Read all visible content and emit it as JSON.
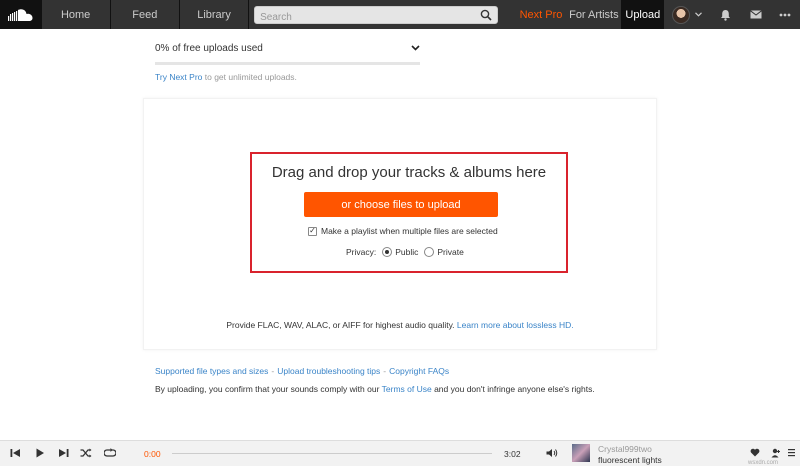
{
  "nav": {
    "home": "Home",
    "feed": "Feed",
    "library": "Library",
    "search_placeholder": "Search",
    "next_pro": "Next Pro",
    "for_artists": "For Artists",
    "upload": "Upload"
  },
  "quota": {
    "text": "0% of free uploads used",
    "percent": 0,
    "link_text": "Try Next Pro",
    "link_suffix": " to get unlimited uploads."
  },
  "dropzone": {
    "title": "Drag and drop your tracks & albums here",
    "choose_button": "or choose files to upload",
    "playlist_checkbox_label": "Make a playlist when multiple files are selected",
    "playlist_checked": true,
    "privacy_label": "Privacy:",
    "privacy_public": "Public",
    "privacy_private": "Private",
    "privacy_selected": "Public"
  },
  "quality": {
    "text": "Provide FLAC, WAV, ALAC, or AIFF for highest audio quality. ",
    "link": "Learn more about lossless HD."
  },
  "help_links": {
    "supported": "Supported file types and sizes",
    "troubleshooting": "Upload troubleshooting tips",
    "copyright": "Copyright FAQs",
    "separator": "-"
  },
  "terms": {
    "prefix": "By uploading, you confirm that your sounds comply with our ",
    "link": "Terms of Use",
    "suffix": " and you don't infringe anyone else's rights."
  },
  "player": {
    "current_time": "0:00",
    "duration": "3:02",
    "track_user": "Crystal999two",
    "track_title": "fluorescent lights"
  },
  "watermark": "wsxdn.com",
  "colors": {
    "accent": "#ff5500",
    "nav_bg": "#333333",
    "link": "#3a84c8",
    "highlight_border": "#d9232d"
  }
}
